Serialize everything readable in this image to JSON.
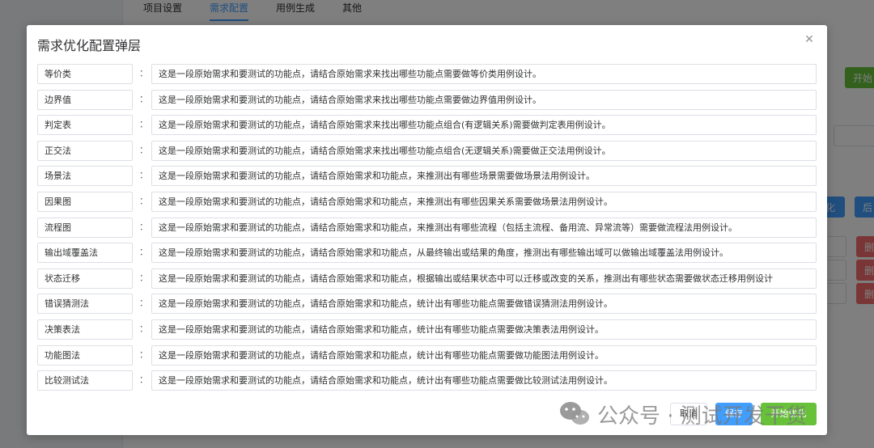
{
  "background": {
    "tabs": [
      {
        "label": "项目设置"
      },
      {
        "label": "需求配置"
      },
      {
        "label": "用例生成"
      },
      {
        "label": "其他"
      }
    ],
    "start_button_partial": "开始",
    "optimize_button_partial": "化",
    "after_button_partial": "后",
    "delete_button_partial": "删"
  },
  "dialog": {
    "title": "需求优化配置弹层",
    "colon": "：",
    "rows": [
      {
        "label": "等价类",
        "value": "这是一段原始需求和要测试的功能点，请结合原始需求来找出哪些功能点需要做等价类用例设计。"
      },
      {
        "label": "边界值",
        "value": "这是一段原始需求和要测试的功能点，请结合原始需求来找出哪些功能点需要做边界值用例设计。"
      },
      {
        "label": "判定表",
        "value": "这是一段原始需求和要测试的功能点，请结合原始需求来找出哪些功能点组合(有逻辑关系)需要做判定表用例设计。"
      },
      {
        "label": "正交法",
        "value": "这是一段原始需求和要测试的功能点，请结合原始需求来找出哪些功能点组合(无逻辑关系)需要做正交法用例设计。"
      },
      {
        "label": "场景法",
        "value": "这是一段原始需求和要测试的功能点，请结合原始需求和功能点，来推测出有哪些场景需要做场景法用例设计。"
      },
      {
        "label": "因果图",
        "value": "这是一段原始需求和要测试的功能点，请结合原始需求和功能点，来推测出有哪些因果关系需要做场景法用例设计。"
      },
      {
        "label": "流程图",
        "value": "这是一段原始需求和要测试的功能点，请结合原始需求和功能点，来推测出有哪些流程（包括主流程、备用流、异常流等）需要做流程法用例设计。"
      },
      {
        "label": "输出域覆盖法",
        "value": "这是一段原始需求和要测试的功能点，请结合原始需求和功能点，从最终输出或结果的角度，推测出有哪些输出域可以做输出域覆盖法用例设计。"
      },
      {
        "label": "状态迁移",
        "value": "这是一段原始需求和要测试的功能点，请结合原始需求和功能点，根据输出或结果状态中可以迁移或改变的关系，推测出有哪些状态需要做状态迁移用例设计"
      },
      {
        "label": "错误猜测法",
        "value": "这是一段原始需求和要测试的功能点，请结合原始需求和功能点，统计出有哪些功能点需要做错误猜测法用例设计。"
      },
      {
        "label": "决策表法",
        "value": "这是一段原始需求和要测试的功能点，请结合原始需求和功能点，统计出有哪些功能点需要做决策表法用例设计。"
      },
      {
        "label": "功能图法",
        "value": "这是一段原始需求和要测试的功能点，请结合原始需求和功能点，统计出有哪些功能点需要做功能图法用例设计。"
      },
      {
        "label": "比较测试法",
        "value": "这是一段原始需求和要测试的功能点，请结合原始需求和功能点，统计出有哪些功能点需要做比较测试法用例设计。"
      }
    ],
    "cancel_label": "取消",
    "save_label": "保存",
    "start_label": "开始优化"
  },
  "watermark": {
    "text": "公众号 · 测试开发干货"
  },
  "colors": {
    "primary": "#409eff",
    "success": "#67c23a",
    "danger": "#f56c6c",
    "overlay": "rgba(0,0,0,0.5)"
  }
}
